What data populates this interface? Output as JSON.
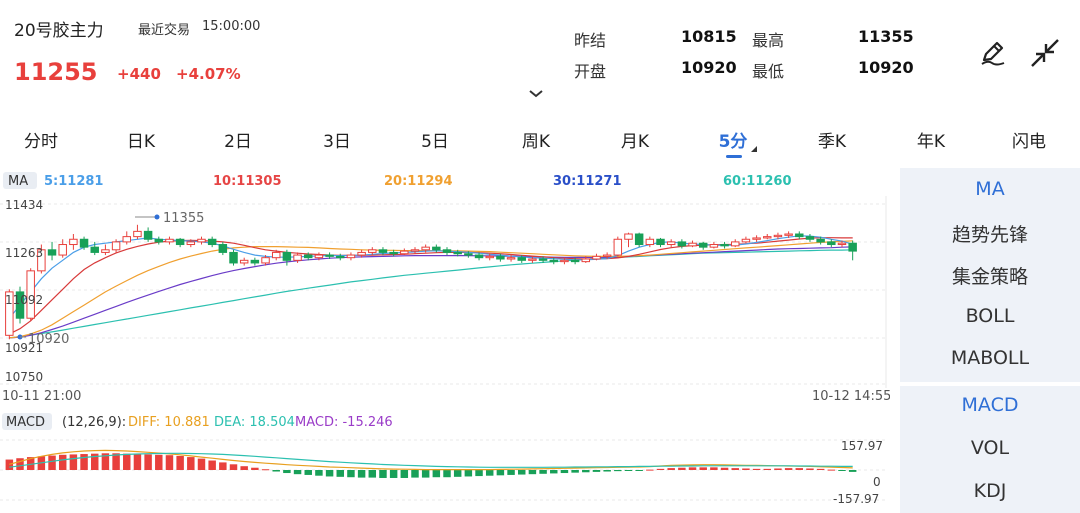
{
  "header": {
    "title": "20号胶主力",
    "last_trade_label": "最近交易",
    "last_trade_time": "15:00:00",
    "price": "11255",
    "change": "+440",
    "change_pct": "+4.07%",
    "stats": [
      {
        "label": "昨结",
        "value": "10815"
      },
      {
        "label": "最高",
        "value": "11355"
      },
      {
        "label": "开盘",
        "value": "10920"
      },
      {
        "label": "最低",
        "value": "10920"
      }
    ],
    "edit_icon": "pen-icon",
    "collapse_icon": "collapse-arrows-icon",
    "chevron_icon": "chevron-down-icon"
  },
  "tabs": [
    "分时",
    "日K",
    "2日",
    "3日",
    "5日",
    "周K",
    "月K",
    "5分",
    "季K",
    "年K",
    "闪电"
  ],
  "active_tab": "5分",
  "side_top": [
    "MA",
    "趋势先锋",
    "集金策略",
    "BOLL",
    "MABOLL"
  ],
  "side_bottom": [
    "MACD",
    "VOL",
    "KDJ"
  ],
  "chart_data": {
    "type": "candlestick",
    "ma_tag": "MA",
    "ma_labels": [
      {
        "label": "5:11281",
        "color": "#4a9ee8"
      },
      {
        "label": "10:11305",
        "color": "#e64545"
      },
      {
        "label": "20:11294",
        "color": "#f0a030"
      },
      {
        "label": "30:11271",
        "color": "#2a4fc8"
      },
      {
        "label": "60:11260",
        "color": "#2cc0b0"
      }
    ],
    "y_ticks": [
      "11434",
      "11263",
      "11092",
      "10921",
      "10750"
    ],
    "ylim": [
      10750,
      11434
    ],
    "high_annotation": "11355",
    "low_annotation": "10920",
    "x_start": "10-11 21:00",
    "x_end": "10-12 14:55",
    "candles": [
      [
        10935,
        11100,
        10920,
        11110
      ],
      [
        11100,
        11000,
        10980,
        11120
      ],
      [
        11000,
        11180,
        10990,
        11190
      ],
      [
        11180,
        11260,
        11170,
        11280
      ],
      [
        11260,
        11240,
        11220,
        11290
      ],
      [
        11240,
        11280,
        11230,
        11300
      ],
      [
        11280,
        11300,
        11260,
        11320
      ],
      [
        11300,
        11270,
        11260,
        11310
      ],
      [
        11270,
        11250,
        11240,
        11290
      ],
      [
        11250,
        11260,
        11240,
        11280
      ],
      [
        11260,
        11290,
        11250,
        11300
      ],
      [
        11290,
        11310,
        11280,
        11330
      ],
      [
        11310,
        11330,
        11300,
        11355
      ],
      [
        11330,
        11300,
        11290,
        11345
      ],
      [
        11300,
        11290,
        11280,
        11310
      ],
      [
        11290,
        11300,
        11280,
        11310
      ],
      [
        11300,
        11280,
        11270,
        11305
      ],
      [
        11280,
        11290,
        11270,
        11300
      ],
      [
        11290,
        11300,
        11280,
        11310
      ],
      [
        11300,
        11280,
        11270,
        11310
      ],
      [
        11280,
        11250,
        11240,
        11290
      ],
      [
        11250,
        11210,
        11200,
        11260
      ],
      [
        11210,
        11220,
        11200,
        11230
      ],
      [
        11220,
        11210,
        11200,
        11230
      ],
      [
        11210,
        11230,
        11200,
        11240
      ],
      [
        11230,
        11250,
        11220,
        11260
      ],
      [
        11250,
        11220,
        11200,
        11260
      ],
      [
        11220,
        11240,
        11210,
        11250
      ],
      [
        11240,
        11230,
        11220,
        11250
      ],
      [
        11230,
        11240,
        11220,
        11250
      ],
      [
        11240,
        11235,
        11225,
        11250
      ],
      [
        11235,
        11230,
        11220,
        11245
      ],
      [
        11230,
        11240,
        11220,
        11250
      ],
      [
        11240,
        11250,
        11230,
        11260
      ],
      [
        11250,
        11260,
        11240,
        11270
      ],
      [
        11260,
        11250,
        11240,
        11270
      ],
      [
        11250,
        11245,
        11235,
        11260
      ],
      [
        11245,
        11255,
        11240,
        11265
      ],
      [
        11255,
        11260,
        11245,
        11270
      ],
      [
        11260,
        11270,
        11250,
        11280
      ],
      [
        11270,
        11260,
        11250,
        11280
      ],
      [
        11260,
        11250,
        11240,
        11270
      ],
      [
        11250,
        11245,
        11235,
        11260
      ],
      [
        11245,
        11240,
        11230,
        11255
      ],
      [
        11240,
        11230,
        11220,
        11250
      ],
      [
        11230,
        11235,
        11220,
        11245
      ],
      [
        11235,
        11225,
        11215,
        11245
      ],
      [
        11225,
        11230,
        11215,
        11240
      ],
      [
        11230,
        11220,
        11210,
        11240
      ],
      [
        11220,
        11225,
        11210,
        11235
      ],
      [
        11225,
        11220,
        11210,
        11235
      ],
      [
        11220,
        11215,
        11205,
        11230
      ],
      [
        11215,
        11220,
        11205,
        11230
      ],
      [
        11220,
        11215,
        11205,
        11230
      ],
      [
        11215,
        11225,
        11210,
        11235
      ],
      [
        11225,
        11235,
        11220,
        11245
      ],
      [
        11235,
        11240,
        11225,
        11250
      ],
      [
        11240,
        11300,
        11235,
        11310
      ],
      [
        11300,
        11320,
        11270,
        11325
      ],
      [
        11320,
        11280,
        11270,
        11325
      ],
      [
        11280,
        11300,
        11270,
        11310
      ],
      [
        11300,
        11280,
        11270,
        11305
      ],
      [
        11280,
        11290,
        11270,
        11300
      ],
      [
        11290,
        11275,
        11265,
        11300
      ],
      [
        11275,
        11285,
        11270,
        11295
      ],
      [
        11285,
        11270,
        11260,
        11290
      ],
      [
        11270,
        11280,
        11265,
        11290
      ],
      [
        11280,
        11275,
        11265,
        11290
      ],
      [
        11275,
        11290,
        11270,
        11300
      ],
      [
        11290,
        11300,
        11285,
        11310
      ],
      [
        11300,
        11305,
        11290,
        11315
      ],
      [
        11305,
        11310,
        11300,
        11320
      ],
      [
        11310,
        11315,
        11300,
        11325
      ],
      [
        11315,
        11320,
        11305,
        11330
      ],
      [
        11320,
        11310,
        11300,
        11330
      ],
      [
        11310,
        11300,
        11290,
        11320
      ],
      [
        11300,
        11290,
        11280,
        11310
      ],
      [
        11290,
        11280,
        11270,
        11300
      ],
      [
        11280,
        11285,
        11270,
        11295
      ],
      [
        11285,
        11255,
        11220,
        11295
      ]
    ],
    "ma5": [
      11000,
      11050,
      11100,
      11150,
      11190,
      11220,
      11250,
      11270,
      11280,
      11285,
      11290,
      11295,
      11300,
      11305,
      11300,
      11298,
      11295,
      11293,
      11290,
      11285,
      11275,
      11262,
      11250,
      11240,
      11235,
      11232,
      11232,
      11233,
      11235,
      11237,
      11238,
      11238,
      11239,
      11240,
      11243,
      11246,
      11248,
      11250,
      11252,
      11255,
      11256,
      11255,
      11253,
      11250,
      11247,
      11243,
      11240,
      11236,
      11233,
      11230,
      11228,
      11226,
      11224,
      11222,
      11222,
      11224,
      11226,
      11238,
      11255,
      11270,
      11280,
      11288,
      11290,
      11285,
      11282,
      11280,
      11278,
      11277,
      11278,
      11282,
      11288,
      11295,
      11302,
      11308,
      11313,
      11312,
      11308,
      11300,
      11293,
      11281
    ],
    "ma10": [
      10940,
      10960,
      10990,
      11030,
      11070,
      11110,
      11150,
      11185,
      11210,
      11230,
      11248,
      11262,
      11273,
      11282,
      11289,
      11293,
      11295,
      11296,
      11295,
      11293,
      11290,
      11285,
      11277,
      11268,
      11260,
      11255,
      11250,
      11247,
      11244,
      11242,
      11240,
      11239,
      11239,
      11239,
      11240,
      11241,
      11242,
      11243,
      11245,
      11247,
      11249,
      11250,
      11250,
      11250,
      11249,
      11247,
      11245,
      11242,
      11239,
      11236,
      11233,
      11230,
      11228,
      11226,
      11225,
      11225,
      11226,
      11229,
      11235,
      11243,
      11252,
      11261,
      11268,
      11273,
      11276,
      11278,
      11279,
      11280,
      11281,
      11283,
      11285,
      11289,
      11293,
      11297,
      11301,
      11304,
      11306,
      11306,
      11305,
      11305
    ],
    "ma20": [
      10925,
      10930,
      10940,
      10955,
      10975,
      11000,
      11025,
      11050,
      11075,
      11100,
      11122,
      11143,
      11163,
      11181,
      11197,
      11212,
      11225,
      11236,
      11246,
      11255,
      11262,
      11267,
      11270,
      11272,
      11272,
      11272,
      11271,
      11270,
      11269,
      11267,
      11265,
      11263,
      11262,
      11260,
      11259,
      11258,
      11258,
      11257,
      11257,
      11257,
      11257,
      11256,
      11256,
      11255,
      11254,
      11253,
      11251,
      11249,
      11247,
      11245,
      11243,
      11241,
      11239,
      11237,
      11236,
      11235,
      11235,
      11235,
      11236,
      11238,
      11240,
      11243,
      11246,
      11249,
      11252,
      11255,
      11258,
      11261,
      11264,
      11267,
      11270,
      11273,
      11276,
      11279,
      11282,
      11285,
      11288,
      11290,
      11292,
      11294
    ],
    "ma30": [
      10925,
      10928,
      10935,
      10945,
      10957,
      10970,
      10985,
      11000,
      11015,
      11030,
      11045,
      11060,
      11074,
      11088,
      11102,
      11115,
      11128,
      11140,
      11151,
      11162,
      11172,
      11181,
      11189,
      11196,
      11203,
      11209,
      11214,
      11218,
      11222,
      11225,
      11228,
      11230,
      11232,
      11233,
      11234,
      11235,
      11236,
      11237,
      11238,
      11238,
      11238,
      11238,
      11238,
      11238,
      11237,
      11237,
      11236,
      11236,
      11235,
      11234,
      11233,
      11232,
      11231,
      11231,
      11231,
      11231,
      11232,
      11233,
      11235,
      11237,
      11239,
      11241,
      11243,
      11245,
      11247,
      11249,
      11251,
      11253,
      11255,
      11257,
      11259,
      11261,
      11263,
      11264,
      11265,
      11266,
      11267,
      11268,
      11270,
      11271
    ],
    "ma60": [
      10925,
      10930,
      10936,
      10942,
      10948,
      10955,
      10962,
      10969,
      10976,
      10983,
      10990,
      10997,
      11004,
      11011,
      11018,
      11025,
      11032,
      11039,
      11046,
      11053,
      11060,
      11067,
      11074,
      11081,
      11088,
      11095,
      11102,
      11108,
      11114,
      11120,
      11126,
      11132,
      11138,
      11143,
      11148,
      11153,
      11158,
      11163,
      11167,
      11171,
      11175,
      11179,
      11183,
      11187,
      11191,
      11195,
      11199,
      11203,
      11206,
      11209,
      11212,
      11215,
      11218,
      11221,
      11224,
      11227,
      11229,
      11231,
      11233,
      11235,
      11237,
      11239,
      11241,
      11243,
      11245,
      11247,
      11248,
      11249,
      11250,
      11251,
      11252,
      11253,
      11254,
      11255,
      11256,
      11257,
      11258,
      11259,
      11259,
      11260
    ],
    "macd": {
      "tag": "MACD",
      "params": "(12,26,9):",
      "diff_label": "DIFF: 10.881",
      "dea_label": "DEA: 18.504",
      "macd_label": "MACD: -15.246",
      "y_top": "157.97",
      "y_zero": "0",
      "y_bottom": "-157.97",
      "ylim": [
        -157.97,
        157.97
      ],
      "bars": [
        55,
        62,
        68,
        72,
        76,
        80,
        82,
        84,
        86,
        88,
        88,
        86,
        84,
        82,
        80,
        78,
        74,
        68,
        60,
        50,
        40,
        30,
        20,
        12,
        4,
        -8,
        -16,
        -22,
        -26,
        -30,
        -34,
        -36,
        -38,
        -40,
        -40,
        -42,
        -42,
        -42,
        -40,
        -40,
        -38,
        -38,
        -36,
        -34,
        -32,
        -30,
        -28,
        -26,
        -24,
        -22,
        -20,
        -18,
        -16,
        -14,
        -12,
        -10,
        -8,
        -6,
        -4,
        -2,
        2,
        6,
        10,
        12,
        14,
        14,
        14,
        12,
        10,
        8,
        6,
        6,
        8,
        10,
        10,
        8,
        6,
        2,
        -4,
        -10
      ],
      "diff": [
        30,
        45,
        60,
        72,
        82,
        90,
        96,
        100,
        102,
        103,
        102,
        100,
        97,
        93,
        89,
        85,
        80,
        74,
        68,
        62,
        56,
        50,
        45,
        40,
        36,
        32,
        28,
        25,
        22,
        19,
        16,
        14,
        12,
        10,
        8,
        6,
        5,
        4,
        3,
        2,
        2,
        2,
        2,
        2,
        2,
        2,
        3,
        4,
        5,
        6,
        7,
        8,
        9,
        10,
        11,
        12,
        13,
        14,
        15,
        16,
        18,
        21,
        24,
        26,
        27,
        28,
        28,
        27,
        26,
        25,
        24,
        23,
        22,
        21,
        20,
        19,
        17,
        15,
        13,
        11
      ],
      "dea": [
        15,
        22,
        30,
        38,
        46,
        53,
        60,
        66,
        71,
        75,
        79,
        82,
        84,
        86,
        87,
        88,
        88,
        87,
        86,
        84,
        82,
        79,
        76,
        72,
        68,
        64,
        60,
        56,
        52,
        48,
        44,
        41,
        38,
        35,
        32,
        29,
        27,
        25,
        23,
        21,
        19,
        18,
        17,
        16,
        15,
        14,
        14,
        14,
        14,
        14,
        14,
        15,
        15,
        16,
        16,
        17,
        17,
        18,
        18,
        19,
        19,
        20,
        20,
        21,
        21,
        22,
        22,
        22,
        22,
        22,
        22,
        22,
        22,
        22,
        21,
        21,
        20,
        20,
        19,
        19
      ]
    }
  }
}
